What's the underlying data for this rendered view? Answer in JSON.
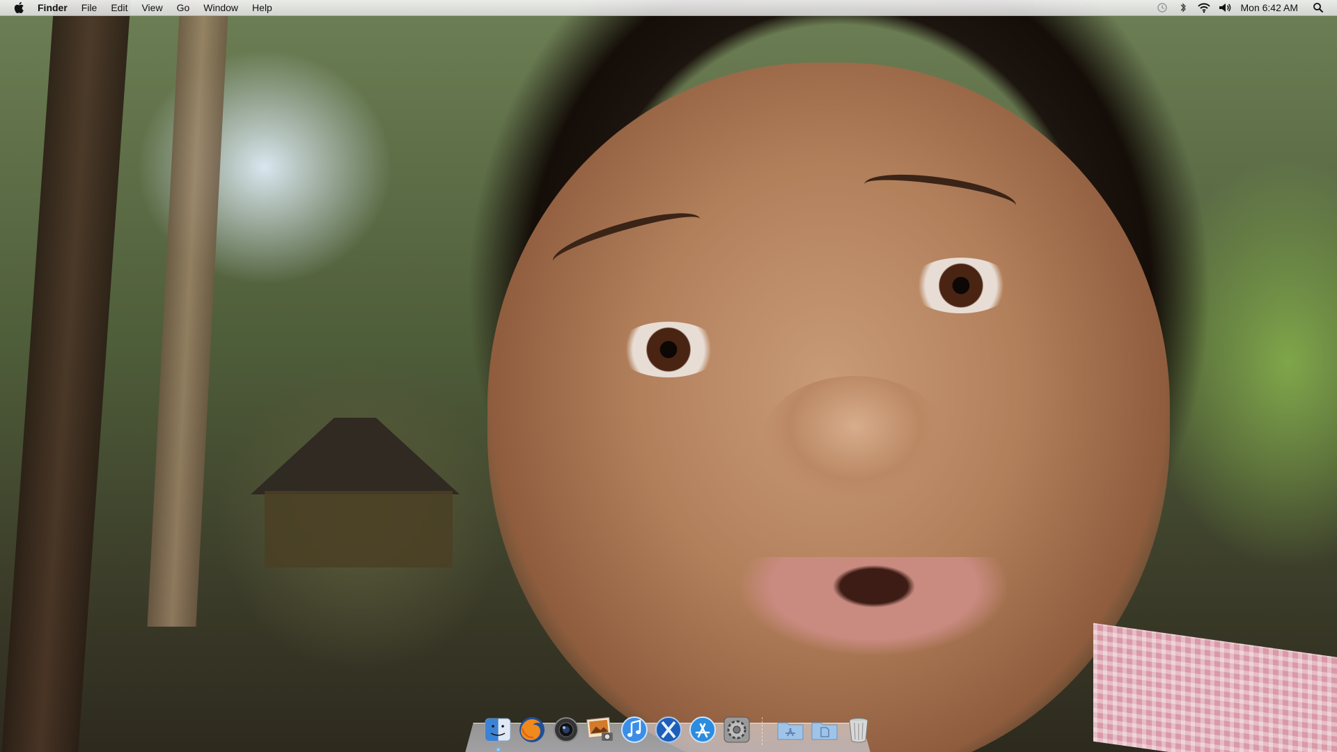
{
  "menubar": {
    "app_name": "Finder",
    "menus": [
      "File",
      "Edit",
      "View",
      "Go",
      "Window",
      "Help"
    ],
    "clock": "Mon 6:42 AM"
  },
  "status_icons": [
    "time-machine-icon",
    "bluetooth-icon",
    "wifi-icon",
    "volume-icon",
    "spotlight-icon"
  ],
  "dock": {
    "apps": [
      {
        "name": "finder-icon",
        "running": true
      },
      {
        "name": "firefox-icon",
        "running": false
      },
      {
        "name": "camera-app-icon",
        "running": false
      },
      {
        "name": "photo-app-icon",
        "running": false
      },
      {
        "name": "itunes-icon",
        "running": false
      },
      {
        "name": "x11-icon",
        "running": false
      },
      {
        "name": "app-store-icon",
        "running": false
      },
      {
        "name": "system-preferences-icon",
        "running": false
      }
    ],
    "folders": [
      "applications-folder-icon",
      "documents-folder-icon"
    ],
    "trash": "trash-icon"
  },
  "colors": {
    "menubar_bg": "#ececec",
    "running_indicator": "#3ba0e8"
  }
}
